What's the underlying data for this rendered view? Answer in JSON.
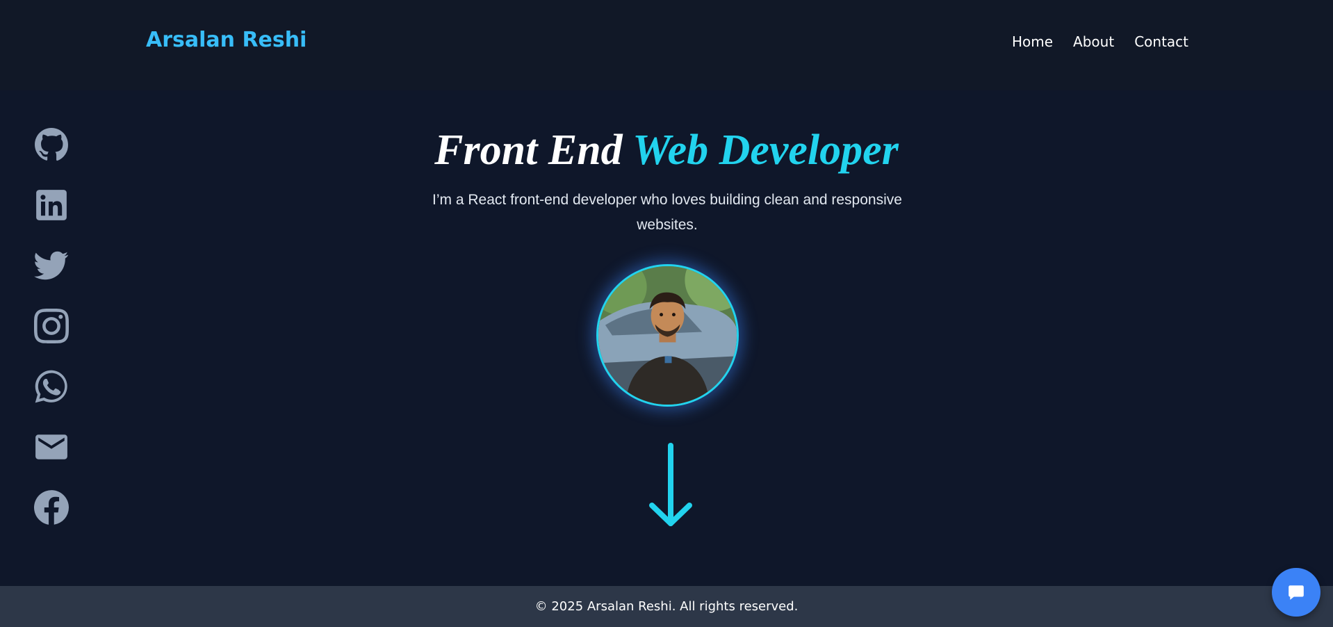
{
  "header": {
    "brand": "Arsalan Reshi",
    "nav": [
      "Home",
      "About",
      "Contact"
    ]
  },
  "social_icons": [
    "github-icon",
    "linkedin-icon",
    "twitter-icon",
    "instagram-icon",
    "whatsapp-icon",
    "email-icon",
    "facebook-icon"
  ],
  "hero": {
    "title_plain": "Front End",
    "title_accent": "Web Developer",
    "description": "I’m a React front-end developer who loves building clean and responsive websites."
  },
  "footer": {
    "text": "© 2025 Arsalan Reshi. All rights reserved."
  },
  "colors": {
    "background": "#0f172a",
    "header_bg": "#111827",
    "accent": "#22d3ee",
    "brand": "#38bdf8",
    "icon": "#94a3b8",
    "footer_bg": "#2d3748",
    "chat_button": "#3b82f6"
  }
}
